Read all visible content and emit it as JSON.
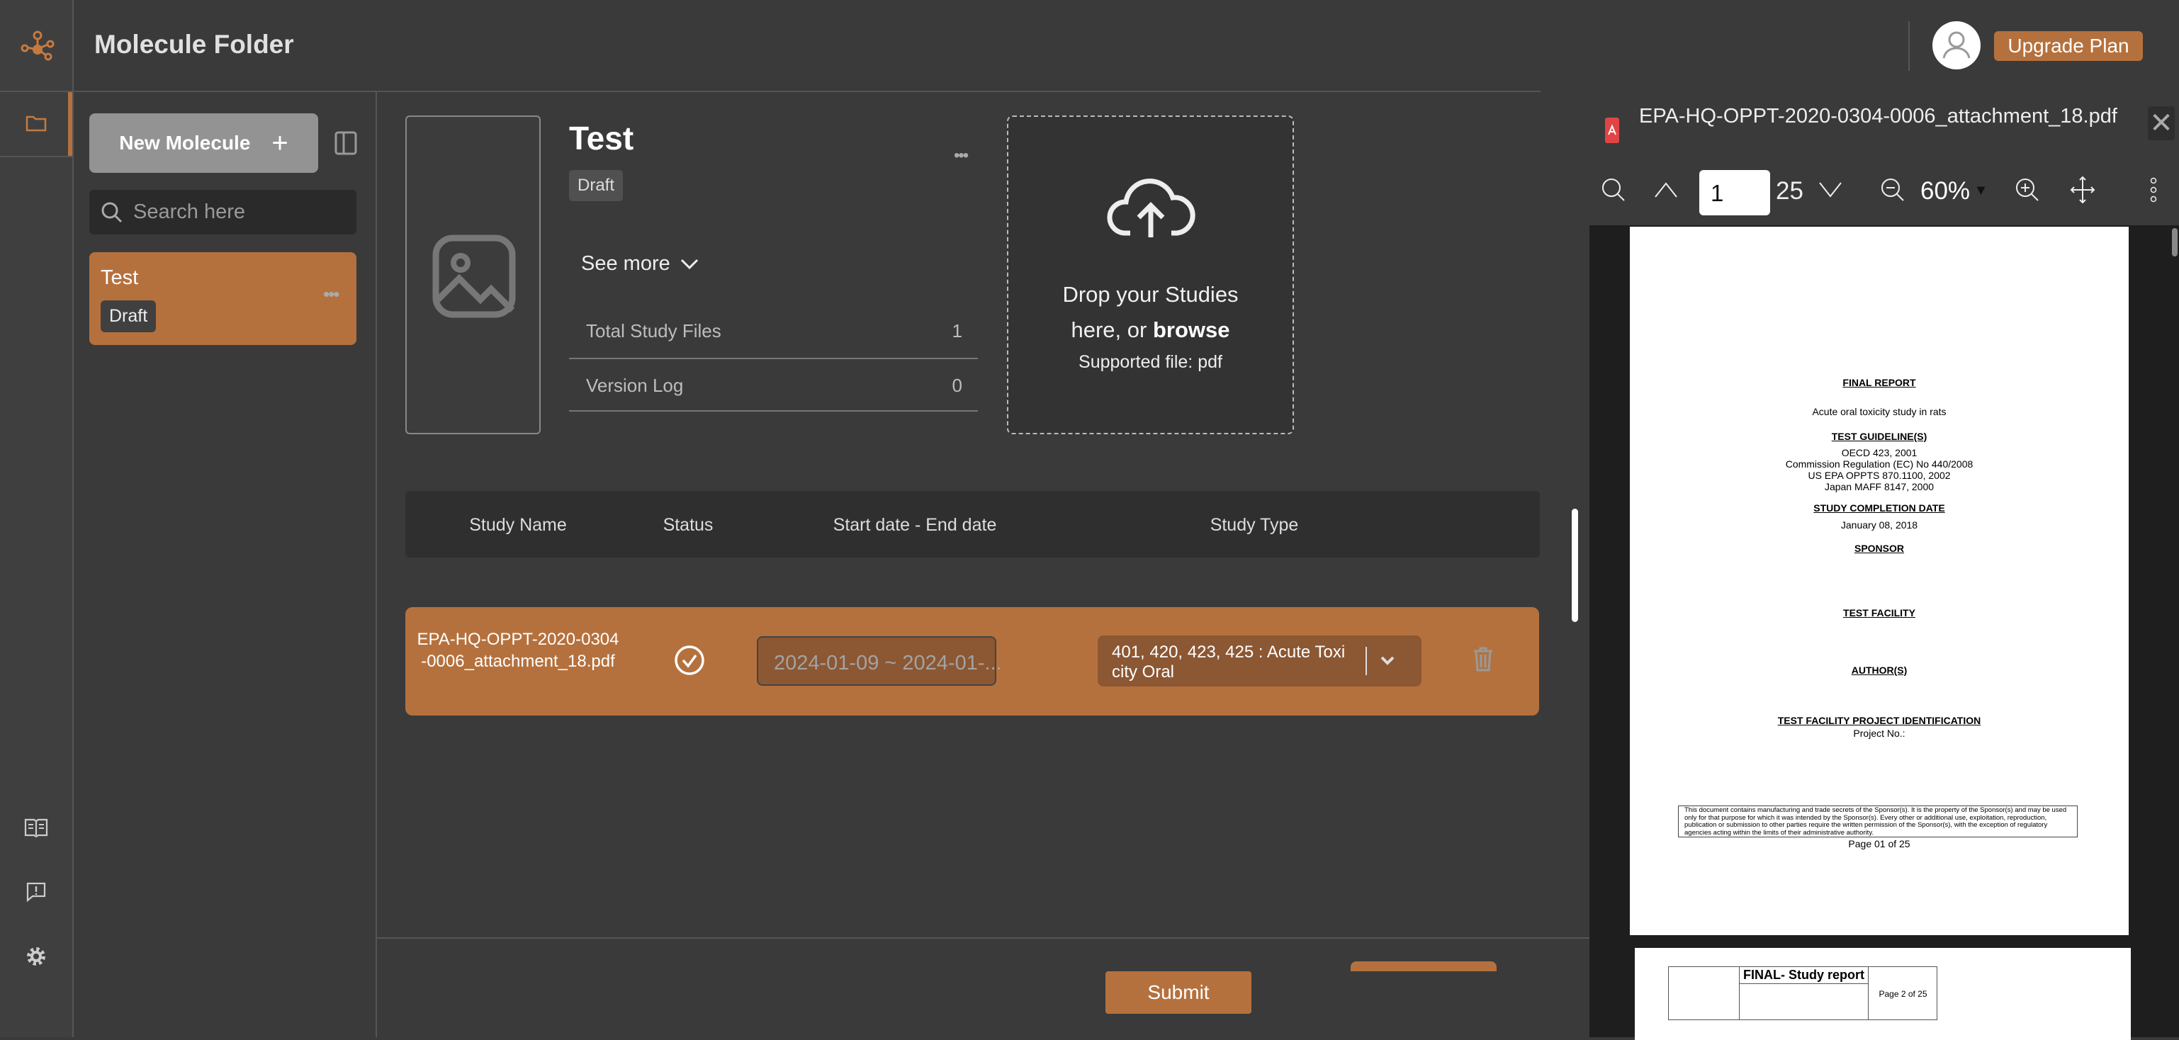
{
  "app": {
    "title": "Molecule Folder",
    "upgrade_label": "Upgrade Plan",
    "accent": "#b5713d"
  },
  "rail": {
    "items": [
      "molecule-logo-icon",
      "folder-icon",
      "book-icon",
      "feedback-icon",
      "gear-icon"
    ]
  },
  "sidebar": {
    "new_button": "New Molecule",
    "search_placeholder": "Search here",
    "molecules": [
      {
        "name": "Test",
        "status": "Draft"
      }
    ]
  },
  "molecule": {
    "name": "Test",
    "status": "Draft",
    "see_more": "See more",
    "stats": [
      {
        "label": "Total Study Files",
        "value": "1"
      },
      {
        "label": "Version Log",
        "value": "0"
      }
    ]
  },
  "dropzone": {
    "line1": "Drop your Studies",
    "line2": "here, or ",
    "browse": "browse",
    "supported": "Supported file: pdf"
  },
  "table": {
    "headers": [
      "Study Name",
      "Status",
      "Start date - End date",
      "Study Type"
    ],
    "rows": [
      {
        "name": "EPA-HQ-OPPT-2020-0304-0006_attachment_18.pdf",
        "status": "complete",
        "dates": "2024-01-09 ~ 2024-01-...",
        "type": "401, 420, 423, 425 : Acute Toxicity Oral"
      }
    ]
  },
  "footer": {
    "submit": "Submit"
  },
  "viewer": {
    "filename": "EPA-HQ-OPPT-2020-0304-0006_attachment_18.pdf",
    "page": "1",
    "total_pages": "25",
    "zoom": "60%",
    "page1": {
      "title": "FINAL REPORT",
      "subtitle": "Acute oral toxicity study in rats",
      "guidelines_heading": "TEST GUIDELINE(S)",
      "guidelines": [
        "OECD 423, 2001",
        "Commission Regulation (EC) No 440/2008",
        "US EPA OPPTS 870.1100, 2002",
        "Japan MAFF 8147, 2000"
      ],
      "completion_heading": "STUDY COMPLETION DATE",
      "completion_date": "January 08, 2018",
      "sponsor": "SPONSOR",
      "facility": "TEST FACILITY",
      "authors": "AUTHOR(S)",
      "project_heading": "TEST FACILITY PROJECT IDENTIFICATION",
      "project_no": "Project No.:",
      "disclaimer": "This document contains manufacturing and trade secrets of the Sponsor(s). It is the property of the Sponsor(s) and may be used only for that purpose for which it was intended by the Sponsor(s). Every other or additional use, exploitation, reproduction, publication or submission to other parties require the written permission of the Sponsor(s), with the exception of regulatory agencies acting within the limits of their administrative authority.",
      "footer": "Page 01 of 25"
    },
    "page2": {
      "title": "FINAL- Study report",
      "page_label": "Page 2 of 25"
    }
  }
}
